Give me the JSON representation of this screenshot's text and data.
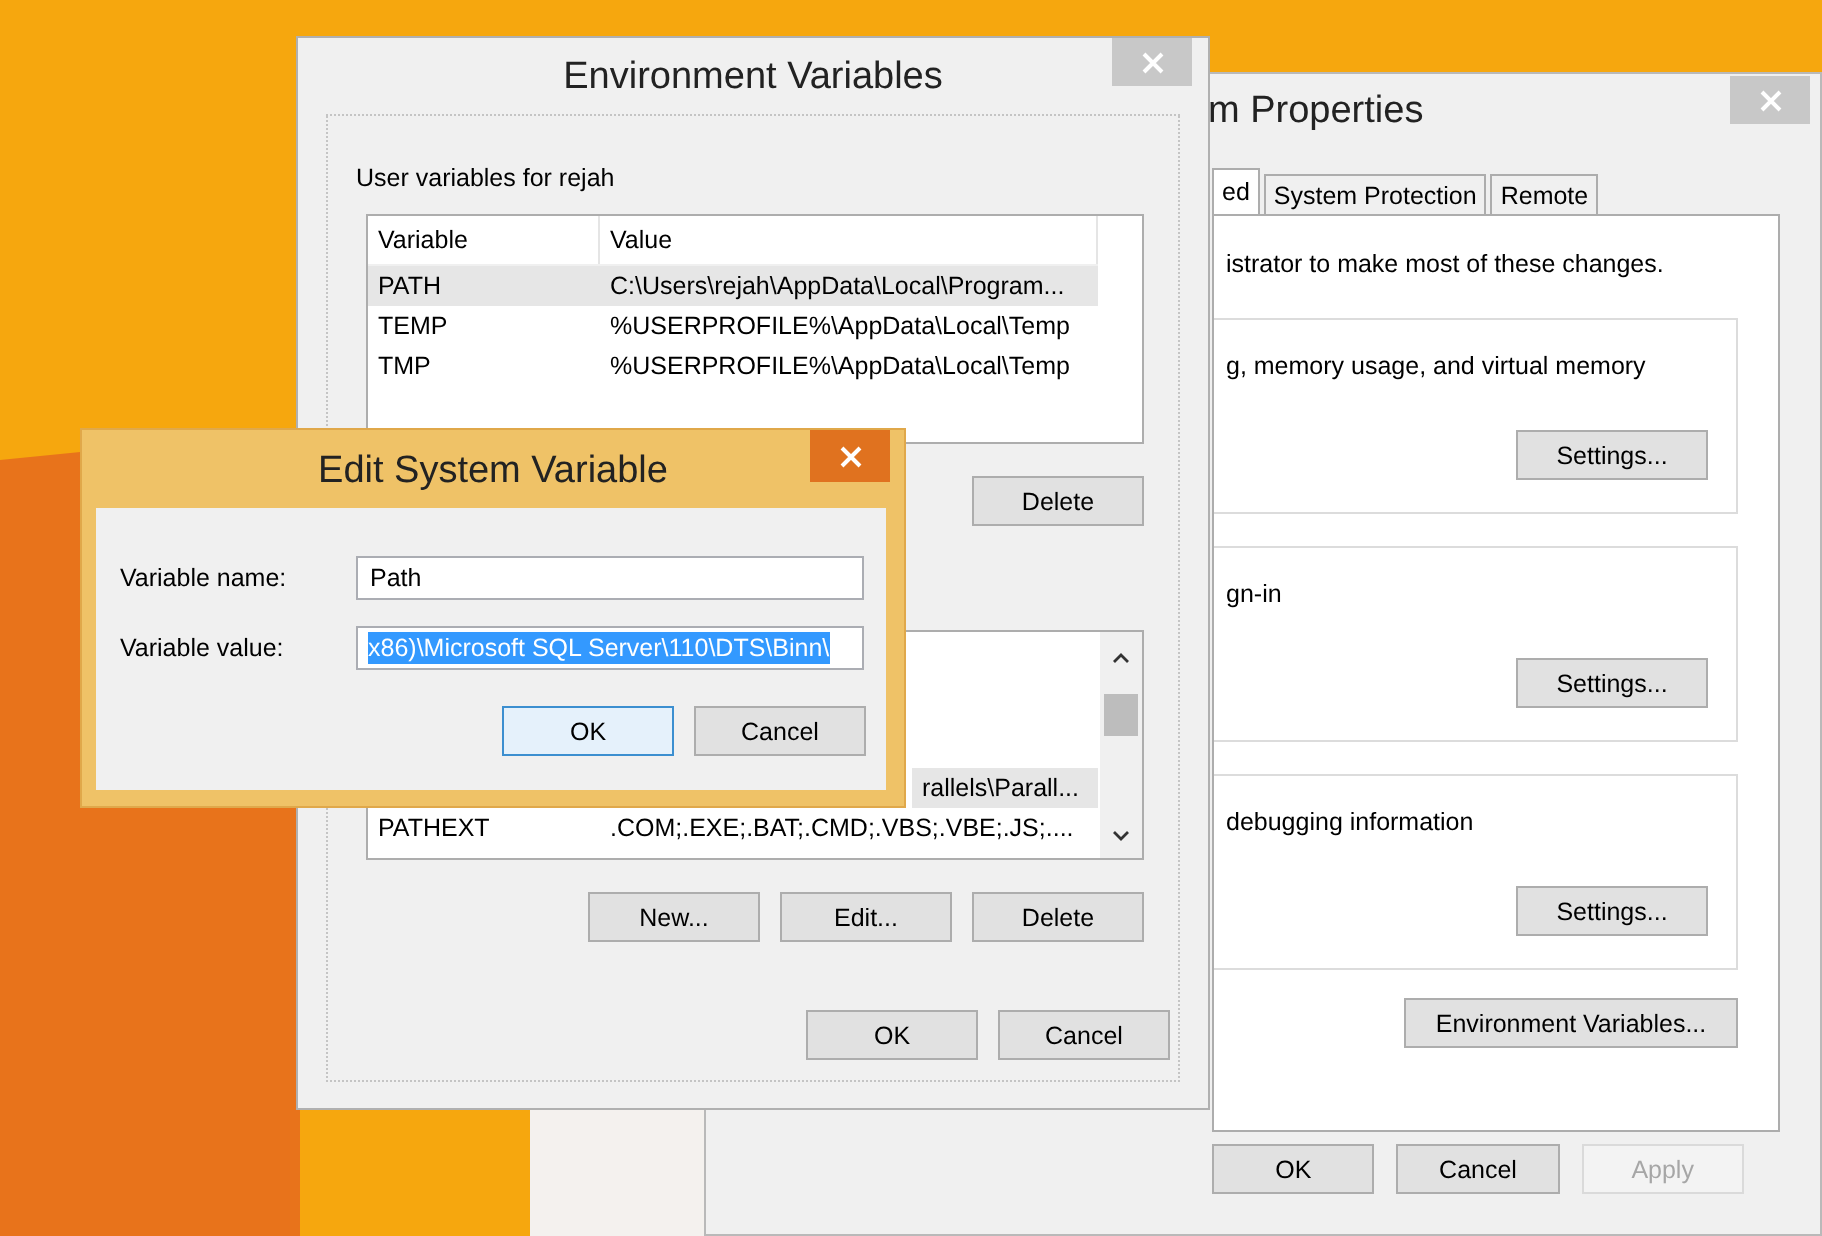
{
  "system_properties": {
    "title": "m Properties",
    "tabs": [
      {
        "label": "ed",
        "selected": true
      },
      {
        "label": "System Protection",
        "selected": false
      },
      {
        "label": "Remote",
        "selected": false
      }
    ],
    "note": "istrator to make most of these changes.",
    "groups": [
      {
        "text": "g, memory usage, and virtual memory",
        "button": "Settings..."
      },
      {
        "text": "gn-in",
        "button": "Settings..."
      },
      {
        "text": "debugging information",
        "button": "Settings..."
      }
    ],
    "environment_button": "Environment Variables...",
    "buttons": [
      {
        "label": "OK",
        "disabled": false
      },
      {
        "label": "Cancel",
        "disabled": false
      },
      {
        "label": "Apply",
        "disabled": true
      }
    ]
  },
  "environment_variables": {
    "title": "Environment Variables",
    "user_section": {
      "label": "User variables for rejah",
      "columns": [
        "Variable",
        "Value"
      ],
      "rows": [
        {
          "variable": "PATH",
          "value": "C:\\Users\\rejah\\AppData\\Local\\Program...",
          "selected": true
        },
        {
          "variable": "TEMP",
          "value": "%USERPROFILE%\\AppData\\Local\\Temp",
          "selected": false
        },
        {
          "variable": "TMP",
          "value": "%USERPROFILE%\\AppData\\Local\\Temp",
          "selected": false
        }
      ],
      "buttons": [
        "Delete"
      ]
    },
    "system_section": {
      "rows": [
        {
          "value": "rallels\\Parall...",
          "selected": true
        },
        {
          "variable": "PATHEXT",
          "value": ".COM;.EXE;.BAT;.CMD;.VBS;.VBE;.JS;....",
          "selected": false
        }
      ],
      "buttons": [
        "New...",
        "Edit...",
        "Delete"
      ]
    },
    "buttons": [
      "OK",
      "Cancel"
    ]
  },
  "edit_dialog": {
    "title": "Edit System Variable",
    "fields": [
      {
        "label": "Variable name:",
        "value": "Path",
        "selected": false
      },
      {
        "label": "Variable value:",
        "value": "x86)\\Microsoft SQL Server\\110\\DTS\\Binn\\",
        "selected": true
      }
    ],
    "buttons": [
      {
        "label": "OK",
        "focused": true
      },
      {
        "label": "Cancel",
        "focused": false
      }
    ]
  }
}
